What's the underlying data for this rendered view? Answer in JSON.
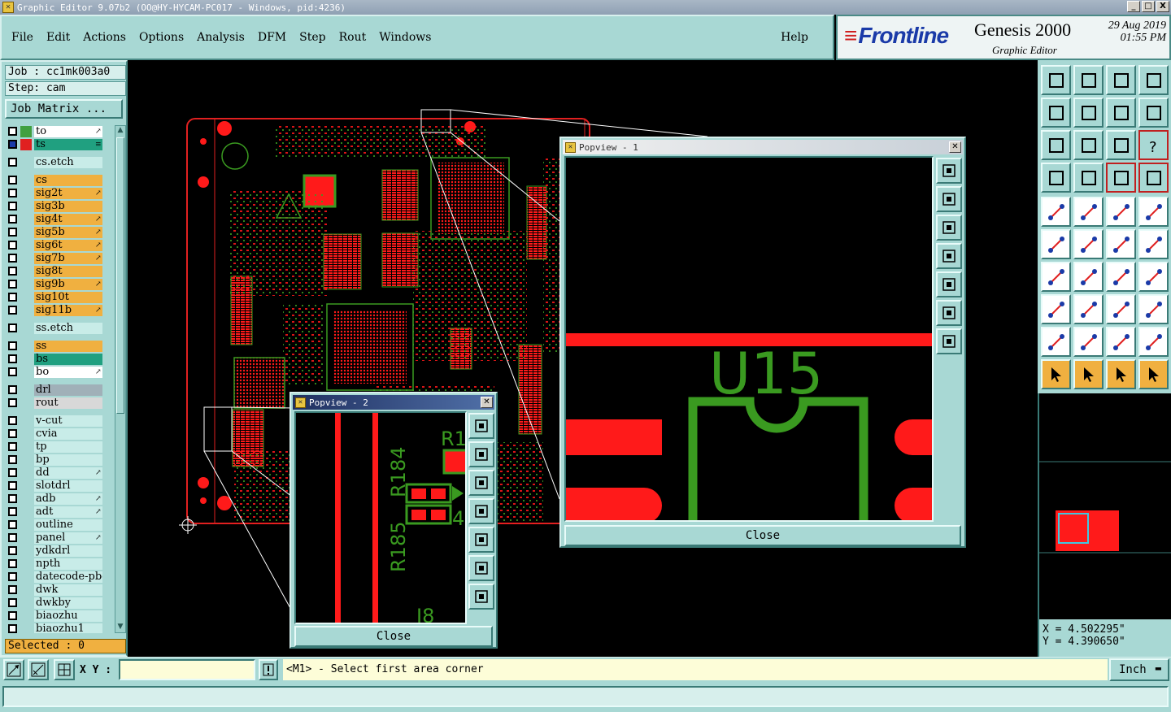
{
  "window": {
    "title": "Graphic Editor 9.07b2 (OO@HY-HYCAM-PC017 - Windows, pid:4236)",
    "controls": [
      "_",
      "□",
      "X"
    ]
  },
  "menu": {
    "items": [
      {
        "label": "File",
        "key": "F"
      },
      {
        "label": "Edit",
        "key": "E"
      },
      {
        "label": "Actions",
        "key": "A"
      },
      {
        "label": "Options",
        "key": "O"
      },
      {
        "label": "Analysis",
        "key": "A"
      },
      {
        "label": "DFM",
        "key": "D"
      },
      {
        "label": "Step",
        "key": "S"
      },
      {
        "label": "Rout",
        "key": "R"
      },
      {
        "label": "Windows",
        "key": "W"
      }
    ],
    "help": "Help"
  },
  "logo": {
    "brand": "Frontline",
    "product": "Genesis 2000",
    "subtitle": "Graphic Editor",
    "date": "29 Aug 2019",
    "time": "01:55 PM"
  },
  "job": {
    "job_line": "Job : cc1mk003a0",
    "step_line": "Step: cam",
    "matrix_button": "Job Matrix ..."
  },
  "layers": [
    {
      "name": "to",
      "bg": "#ffffff",
      "color": "#40a040",
      "mark": "↗"
    },
    {
      "name": "ts",
      "bg": "#20a080",
      "color": "#e02020",
      "mark": "≡",
      "active": true
    },
    {
      "name": "cs.etch",
      "bg": "#c8ece8",
      "color": null
    },
    {
      "name": "cs",
      "bg": "#f0b040",
      "color": null
    },
    {
      "name": "sig2t",
      "bg": "#f0b040",
      "color": null,
      "mark": "↗"
    },
    {
      "name": "sig3b",
      "bg": "#f0b040",
      "color": null
    },
    {
      "name": "sig4t",
      "bg": "#f0b040",
      "color": null,
      "mark": "↗"
    },
    {
      "name": "sig5b",
      "bg": "#f0b040",
      "color": null,
      "mark": "↗"
    },
    {
      "name": "sig6t",
      "bg": "#f0b040",
      "color": null,
      "mark": "↗"
    },
    {
      "name": "sig7b",
      "bg": "#f0b040",
      "color": null,
      "mark": "↗"
    },
    {
      "name": "sig8t",
      "bg": "#f0b040",
      "color": null
    },
    {
      "name": "sig9b",
      "bg": "#f0b040",
      "color": null,
      "mark": "↗"
    },
    {
      "name": "sig10t",
      "bg": "#f0b040",
      "color": null
    },
    {
      "name": "sig11b",
      "bg": "#f0b040",
      "color": null,
      "mark": "↗"
    },
    {
      "name": "ss.etch",
      "bg": "#c8ece8",
      "color": null
    },
    {
      "name": "ss",
      "bg": "#f0b040",
      "color": null
    },
    {
      "name": "bs",
      "bg": "#20a080",
      "color": null
    },
    {
      "name": "bo",
      "bg": "#ffffff",
      "color": null,
      "mark": "↗"
    },
    {
      "name": "drl",
      "bg": "#a0b0b8",
      "color": null
    },
    {
      "name": "rout",
      "bg": "#d8d8d8",
      "color": null
    },
    {
      "name": "v-cut",
      "bg": "#c8ece8",
      "color": null
    },
    {
      "name": "cvia",
      "bg": "#c8ece8",
      "color": null
    },
    {
      "name": "tp",
      "bg": "#c8ece8",
      "color": null
    },
    {
      "name": "bp",
      "bg": "#c8ece8",
      "color": null
    },
    {
      "name": "dd",
      "bg": "#c8ece8",
      "color": null,
      "mark": "↗"
    },
    {
      "name": "slotdrl",
      "bg": "#c8ece8",
      "color": null
    },
    {
      "name": "adb",
      "bg": "#c8ece8",
      "color": null,
      "mark": "↗"
    },
    {
      "name": "adt",
      "bg": "#c8ece8",
      "color": null,
      "mark": "↗"
    },
    {
      "name": "outline",
      "bg": "#c8ece8",
      "color": null
    },
    {
      "name": "panel",
      "bg": "#c8ece8",
      "color": null,
      "mark": "↗"
    },
    {
      "name": "ydkdrl",
      "bg": "#c8ece8",
      "color": null
    },
    {
      "name": "npth",
      "bg": "#c8ece8",
      "color": null
    },
    {
      "name": "datecode-pbe",
      "bg": "#c8ece8",
      "color": null
    },
    {
      "name": "dwk",
      "bg": "#c8ece8",
      "color": null
    },
    {
      "name": "dwkby",
      "bg": "#c8ece8",
      "color": null
    },
    {
      "name": "biaozhu",
      "bg": "#c8ece8",
      "color": null
    },
    {
      "name": "biaozhu1",
      "bg": "#c8ece8",
      "color": null
    }
  ],
  "selected": "Selected : 0",
  "popview1": {
    "title": "Popview - 1",
    "close": "Close",
    "refdes": "U15"
  },
  "popview2": {
    "title": "Popview - 2",
    "close": "Close",
    "refdes_a": "R185",
    "refdes_b": "R184",
    "refdes_c": "R1",
    "refdes_d": "4",
    "refdes_e": "I8"
  },
  "coords": {
    "x": "X = 4.502295\"",
    "y": "Y = 4.390650\""
  },
  "bottom": {
    "xy_label": "X Y :",
    "xy_value": "",
    "prompt": "<M1> - Select first area corner",
    "units": "Inch"
  },
  "colors": {
    "panel": "#a8d8d4",
    "copper": "#ff1a1a",
    "silk": "#3a9a20"
  }
}
